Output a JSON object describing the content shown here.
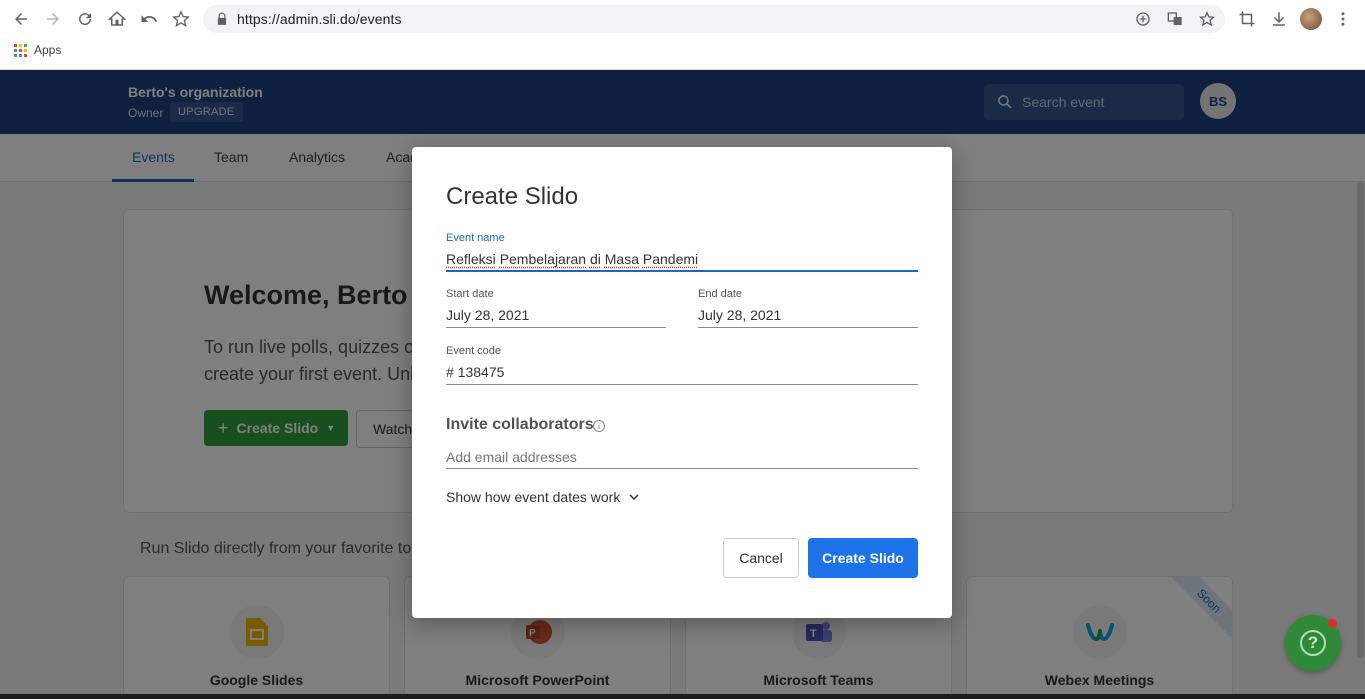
{
  "browser": {
    "url": "https://admin.sli.do/events",
    "bookmarks_apps": "Apps",
    "colors": {
      "apps_grid": [
        "#ea4335",
        "#fbbc04",
        "#34a853",
        "#4285f4",
        "#ea4335",
        "#fbbc04",
        "#34a853",
        "#4285f4",
        "#ea4335"
      ]
    }
  },
  "header": {
    "org_name": "Berto's organization",
    "role": "Owner",
    "upgrade": "UPGRADE",
    "search_placeholder": "Search event",
    "user_initials": "BS"
  },
  "tabs": [
    {
      "label": "Events",
      "active": true
    },
    {
      "label": "Team"
    },
    {
      "label": "Analytics"
    },
    {
      "label": "Acad"
    }
  ],
  "welcome": {
    "title": "Welcome, Berto",
    "line1": "To run live polls, quizzes o",
    "line2": "create your first event. Unl",
    "create_button": "Create Slido",
    "watch_button": "Watch"
  },
  "integrations": {
    "intro": "Run Slido directly from your favorite to",
    "items": [
      {
        "label": "Google Slides",
        "icon": "google-slides-icon"
      },
      {
        "label": "Microsoft PowerPoint",
        "icon": "powerpoint-icon"
      },
      {
        "label": "Microsoft Teams",
        "icon": "teams-icon"
      },
      {
        "label": "Webex Meetings",
        "icon": "webex-icon"
      }
    ],
    "soon": "Soon"
  },
  "modal": {
    "title": "Create Slido",
    "event_name_label": "Event name",
    "event_name_words": [
      "Refleksi",
      "Pembelajaran",
      "di",
      "Masa",
      "Pandemi"
    ],
    "start_date_label": "Start date",
    "start_date": "July 28, 2021",
    "end_date_label": "End date",
    "end_date": "July 28, 2021",
    "event_code_label": "Event code",
    "event_code_prefix": "#",
    "event_code": "138475",
    "invite_title": "Invite collaborators",
    "invite_placeholder": "Add email addresses",
    "show_dates": "Show how event dates work",
    "cancel": "Cancel",
    "create": "Create Slido"
  },
  "help": {
    "icon": "?"
  },
  "colors": {
    "header_bg": "#1e3f7f",
    "accent": "#1e66c3",
    "primary_button": "#1e73e8",
    "green_button": "#2d9e3a"
  }
}
